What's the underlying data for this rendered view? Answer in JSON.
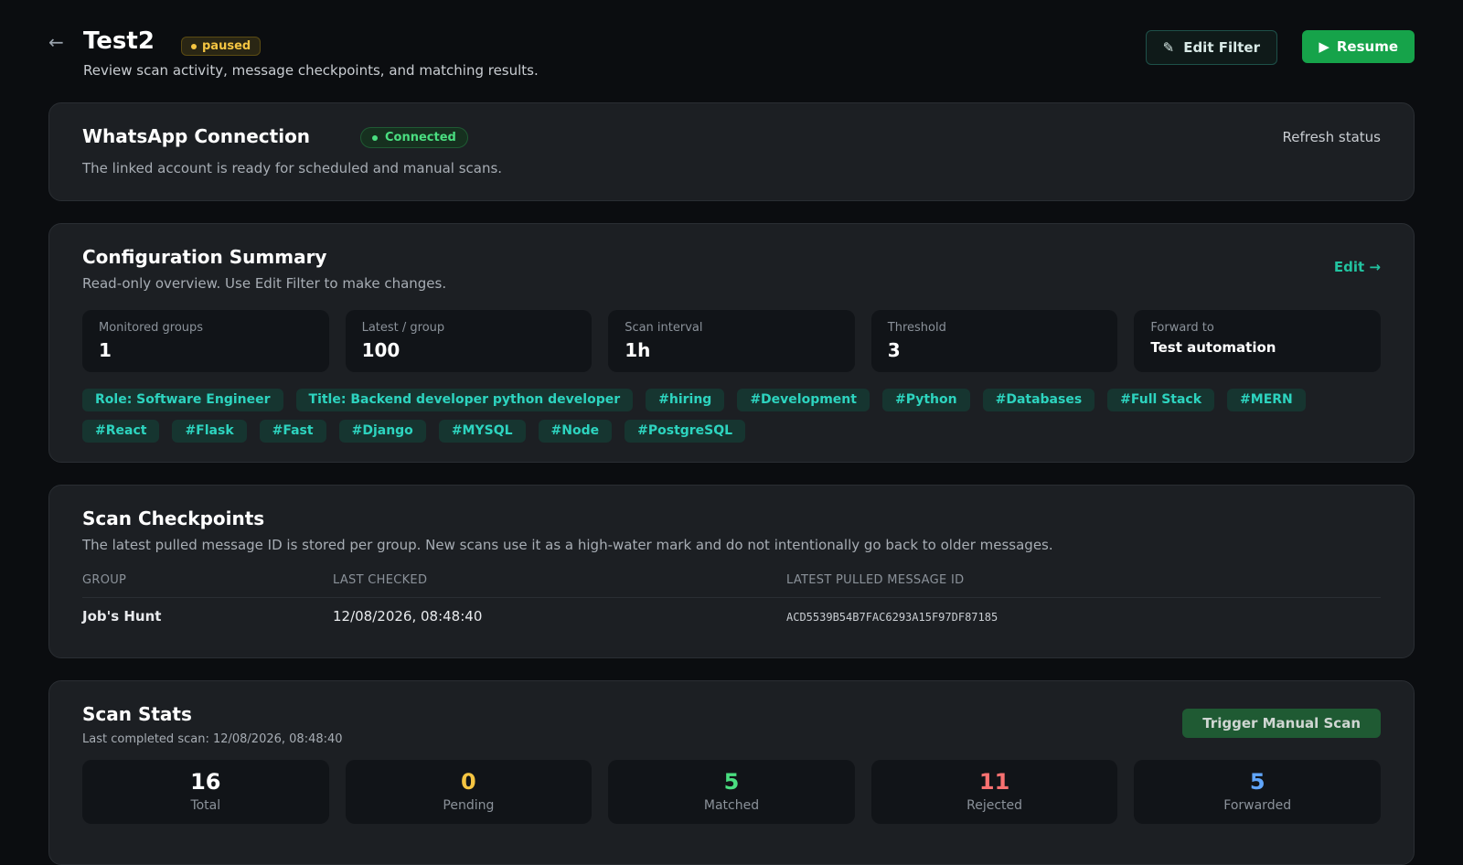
{
  "header": {
    "back_icon": "←",
    "title": "Test2",
    "status": "paused",
    "subtitle": "Review scan activity, message checkpoints, and matching results.",
    "edit_filter_label": "Edit Filter",
    "edit_filter_icon": "✎",
    "resume_label": "Resume",
    "resume_icon": "▶"
  },
  "connection": {
    "title": "WhatsApp Connection",
    "status": "Connected",
    "description": "The linked account is ready for scheduled and manual scans.",
    "refresh_label": "Refresh status"
  },
  "config": {
    "title": "Configuration Summary",
    "description": "Read-only overview. Use Edit Filter to make changes.",
    "edit_label": "Edit →",
    "tiles": [
      {
        "label": "Monitored groups",
        "value": "1"
      },
      {
        "label": "Latest / group",
        "value": "100"
      },
      {
        "label": "Scan interval",
        "value": "1h"
      },
      {
        "label": "Threshold",
        "value": "3"
      },
      {
        "label": "Forward to",
        "value": "Test automation"
      }
    ],
    "tags": [
      "Role: Software Engineer",
      "Title: Backend developer python developer",
      "#hiring",
      "#Development",
      "#Python",
      "#Databases",
      "#Full Stack",
      "#MERN",
      "#React",
      "#Flask",
      "#Fast",
      "#Django",
      "#MYSQL",
      "#Node",
      "#PostgreSQL"
    ]
  },
  "checkpoints": {
    "title": "Scan Checkpoints",
    "description": "The latest pulled message ID is stored per group. New scans use it as a high-water mark and do not intentionally go back to older messages.",
    "columns": [
      "GROUP",
      "LAST CHECKED",
      "LATEST PULLED MESSAGE ID"
    ],
    "rows": [
      {
        "group": "Job's Hunt",
        "last_checked": "12/08/2026, 08:48:40",
        "message_id": "ACD5539B54B7FAC6293A15F97DF87185"
      }
    ]
  },
  "stats": {
    "title": "Scan Stats",
    "last_completed": "Last completed scan: 12/08/2026, 08:48:40",
    "trigger_label": "Trigger Manual Scan",
    "counts": [
      {
        "value": "16",
        "label": "Total",
        "color": "#ffffff"
      },
      {
        "value": "0",
        "label": "Pending",
        "color": "#f5c542"
      },
      {
        "value": "5",
        "label": "Matched",
        "color": "#4ade80"
      },
      {
        "value": "11",
        "label": "Rejected",
        "color": "#f87171"
      },
      {
        "value": "5",
        "label": "Forwarded",
        "color": "#60a5fa"
      }
    ]
  },
  "colors": {
    "background": "#0b0d10",
    "card": "#1c1f23",
    "accent": "#22c3a0",
    "primary_button": "#16a34a"
  }
}
